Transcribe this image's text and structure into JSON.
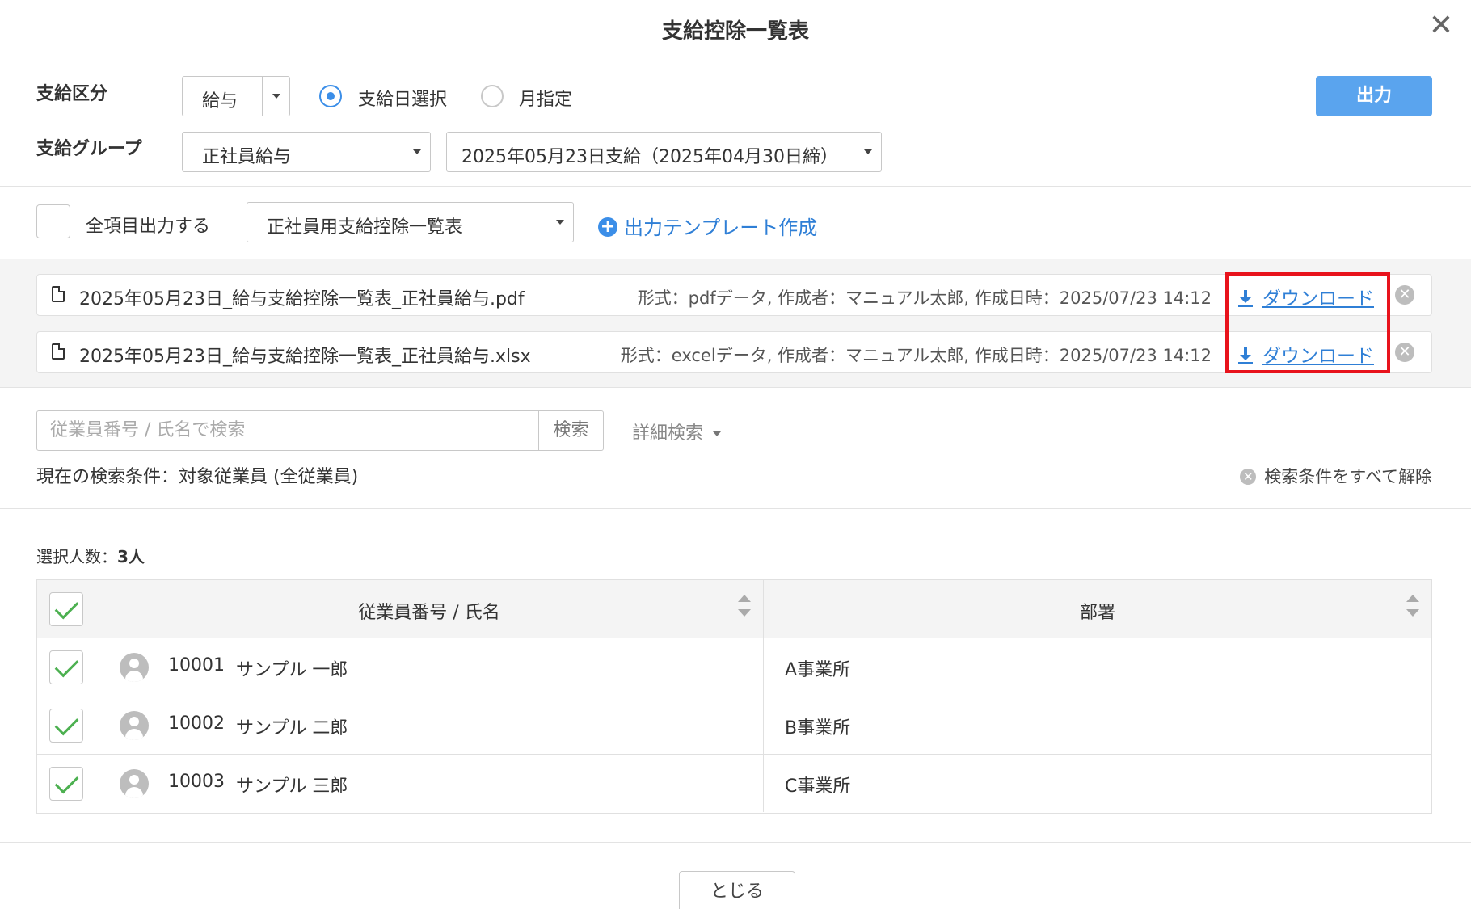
{
  "modal": {
    "title": "支給控除一覧表",
    "close_icon": "close-icon"
  },
  "filters": {
    "pay_type_label": "支給区分",
    "pay_type_value": "給与",
    "radio_payday": "支給日選択",
    "radio_month": "月指定",
    "selected_radio": "支給日選択",
    "group_label": "支給グループ",
    "group_value": "正社員給与",
    "payday_value": "2025年05月23日支給（2025年04月30日締）",
    "output_button": "出力"
  },
  "template": {
    "all_items_label": "全項目出力する",
    "all_items_checked": false,
    "template_value": "正社員用支給控除一覧表",
    "create_template_link": "出力テンプレート作成"
  },
  "files": [
    {
      "name": "2025年05月23日_給与支給控除一覧表_正社員給与.pdf",
      "meta": "形式：pdfデータ, 作成者：マニュアル太郎, 作成日時：2025/07/23 14:12",
      "download": "ダウンロード"
    },
    {
      "name": "2025年05月23日_給与支給控除一覧表_正社員給与.xlsx",
      "meta": "形式：excelデータ, 作成者：マニュアル太郎, 作成日時：2025/07/23 14:12",
      "download": "ダウンロード"
    }
  ],
  "search": {
    "placeholder": "従業員番号 / 氏名で検索",
    "button": "検索",
    "advanced": "詳細検索",
    "current_conditions": "現在の検索条件：対象従業員 (全従業員)",
    "clear_all": "検索条件をすべて解除"
  },
  "selection": {
    "count_label": "選択人数：",
    "count_value": "3人"
  },
  "table": {
    "headers": [
      "従業員番号 / 氏名",
      "部署"
    ],
    "rows": [
      {
        "id": "10001",
        "name": "サンプル 一郎",
        "dept": "A事業所",
        "checked": true
      },
      {
        "id": "10002",
        "name": "サンプル 二郎",
        "dept": "B事業所",
        "checked": true
      },
      {
        "id": "10003",
        "name": "サンプル 三郎",
        "dept": "C事業所",
        "checked": true
      }
    ]
  },
  "footer": {
    "close_button": "とじる"
  },
  "colors": {
    "accent": "#3b8ee8",
    "primary_button": "#5aa4ee",
    "link": "#2f7fd6",
    "highlight": "#e8131c",
    "check": "#4cb050"
  }
}
